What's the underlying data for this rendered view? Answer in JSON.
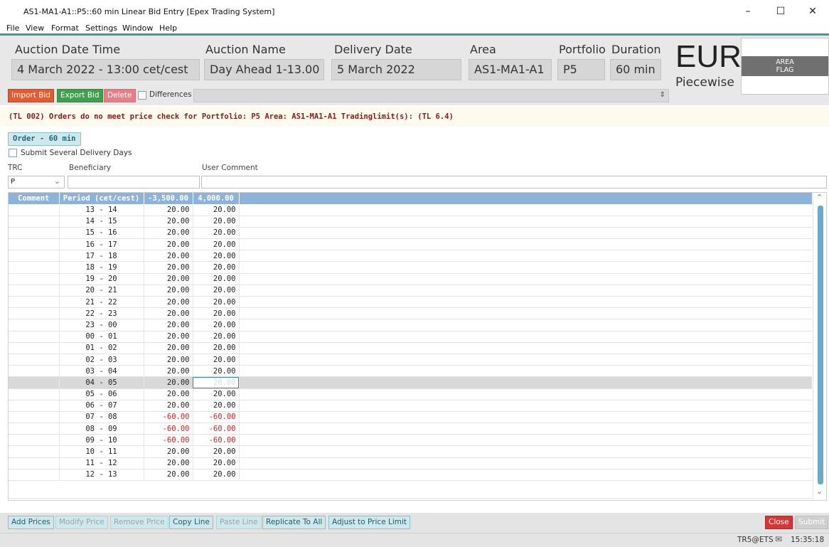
{
  "window": {
    "title": "AS1-MA1-A1::P5::60 min Linear Bid Entry [Epex Trading System]",
    "minimize_glyph": "–",
    "maximize_glyph": "☐",
    "close_glyph": "✕"
  },
  "menu": [
    "File",
    "View",
    "Format",
    "Settings",
    "Window",
    "Help"
  ],
  "header": {
    "auction_datetime_label": "Auction Date Time",
    "auction_datetime_value": "4 March 2022 - 13:00 cet/cest",
    "auction_name_label": "Auction Name",
    "auction_name_value": "Day Ahead 1-13.00",
    "delivery_date_label": "Delivery Date",
    "delivery_date_value": "5 March 2022",
    "area_label": "Area",
    "area_value": "AS1-MA1-A1",
    "portfolio_label": "Portfolio",
    "portfolio_value": "P5",
    "duration_label": "Duration",
    "duration_value": "60 min",
    "currency": "EUR",
    "curve_type": "Piecewise",
    "area_flag_line1": "AREA",
    "area_flag_line2": "FLAG"
  },
  "toolbar": {
    "import_bid": "Import Bid",
    "export_bid": "Export Bid",
    "delete": "Delete",
    "differences": "Differences"
  },
  "error_message": "(TL 002) Orders do no meet price check for Portfolio: P5 Area: AS1-MA1-A1 Tradinglimit(s): (TL 6.4)",
  "order_tab": "Order - 60 min",
  "submit_several_days": "Submit Several Delivery Days",
  "fields": {
    "trc_label": "TRC",
    "trc_value": "P",
    "beneficiary_label": "Beneficiary",
    "beneficiary_value": "",
    "user_comment_label": "User Comment",
    "user_comment_value": ""
  },
  "grid": {
    "headers": [
      "Comment",
      "Period (cet/cest)",
      "-3,500.00",
      "4,000.00"
    ],
    "rows": [
      {
        "comment": "",
        "period": "13 - 14",
        "v1": "20.00",
        "v2": "20.00"
      },
      {
        "comment": "",
        "period": "14 - 15",
        "v1": "20.00",
        "v2": "20.00"
      },
      {
        "comment": "",
        "period": "15 - 16",
        "v1": "20.00",
        "v2": "20.00"
      },
      {
        "comment": "",
        "period": "16 - 17",
        "v1": "20.00",
        "v2": "20.00"
      },
      {
        "comment": "",
        "period": "17 - 18",
        "v1": "20.00",
        "v2": "20.00"
      },
      {
        "comment": "",
        "period": "18 - 19",
        "v1": "20.00",
        "v2": "20.00"
      },
      {
        "comment": "",
        "period": "19 - 20",
        "v1": "20.00",
        "v2": "20.00"
      },
      {
        "comment": "",
        "period": "20 - 21",
        "v1": "20.00",
        "v2": "20.00"
      },
      {
        "comment": "",
        "period": "21 - 22",
        "v1": "20.00",
        "v2": "20.00"
      },
      {
        "comment": "",
        "period": "22 - 23",
        "v1": "20.00",
        "v2": "20.00"
      },
      {
        "comment": "",
        "period": "23 - 00",
        "v1": "20.00",
        "v2": "20.00"
      },
      {
        "comment": "",
        "period": "00 - 01",
        "v1": "20.00",
        "v2": "20.00"
      },
      {
        "comment": "",
        "period": "01 - 02",
        "v1": "20.00",
        "v2": "20.00"
      },
      {
        "comment": "",
        "period": "02 - 03",
        "v1": "20.00",
        "v2": "20.00"
      },
      {
        "comment": "",
        "period": "03 - 04",
        "v1": "20.00",
        "v2": "20.00"
      },
      {
        "comment": "",
        "period": "04 - 05",
        "v1": "20.00",
        "v2": "20.00",
        "selected": true
      },
      {
        "comment": "",
        "period": "05 - 06",
        "v1": "20.00",
        "v2": "20.00"
      },
      {
        "comment": "",
        "period": "06 - 07",
        "v1": "20.00",
        "v2": "20.00"
      },
      {
        "comment": "",
        "period": "07 - 08",
        "v1": "-60.00",
        "v2": "-60.00",
        "negative": true
      },
      {
        "comment": "",
        "period": "08 - 09",
        "v1": "-60.00",
        "v2": "-60.00",
        "negative": true
      },
      {
        "comment": "",
        "period": "09 - 10",
        "v1": "-60.00",
        "v2": "-60.00",
        "negative": true
      },
      {
        "comment": "",
        "period": "10 - 11",
        "v1": "20.00",
        "v2": "20.00"
      },
      {
        "comment": "",
        "period": "11 - 12",
        "v1": "20.00",
        "v2": "20.00"
      },
      {
        "comment": "",
        "period": "12 - 13",
        "v1": "20.00",
        "v2": "20.00"
      }
    ]
  },
  "bottom_buttons": {
    "add_prices": "Add Prices",
    "modify_price": "Modify Price",
    "remove_price": "Remove Price",
    "copy_line": "Copy Line",
    "paste_line": "Paste Line",
    "replicate_to_all": "Replicate To All",
    "adjust_to_price_limit": "Adjust to Price Limit",
    "close": "Close",
    "submit": "Submit"
  },
  "status": {
    "user": "TR5@ETS",
    "time": "15:35:18"
  },
  "colors": {
    "accent_teal": "#3a9aa8",
    "grid_header": "#8eb3db",
    "error_text": "#8b1a1a",
    "negative_value": "#d42020",
    "import_button": "#e55a2e",
    "export_button": "#3ea04a",
    "close_button": "#d93434"
  }
}
